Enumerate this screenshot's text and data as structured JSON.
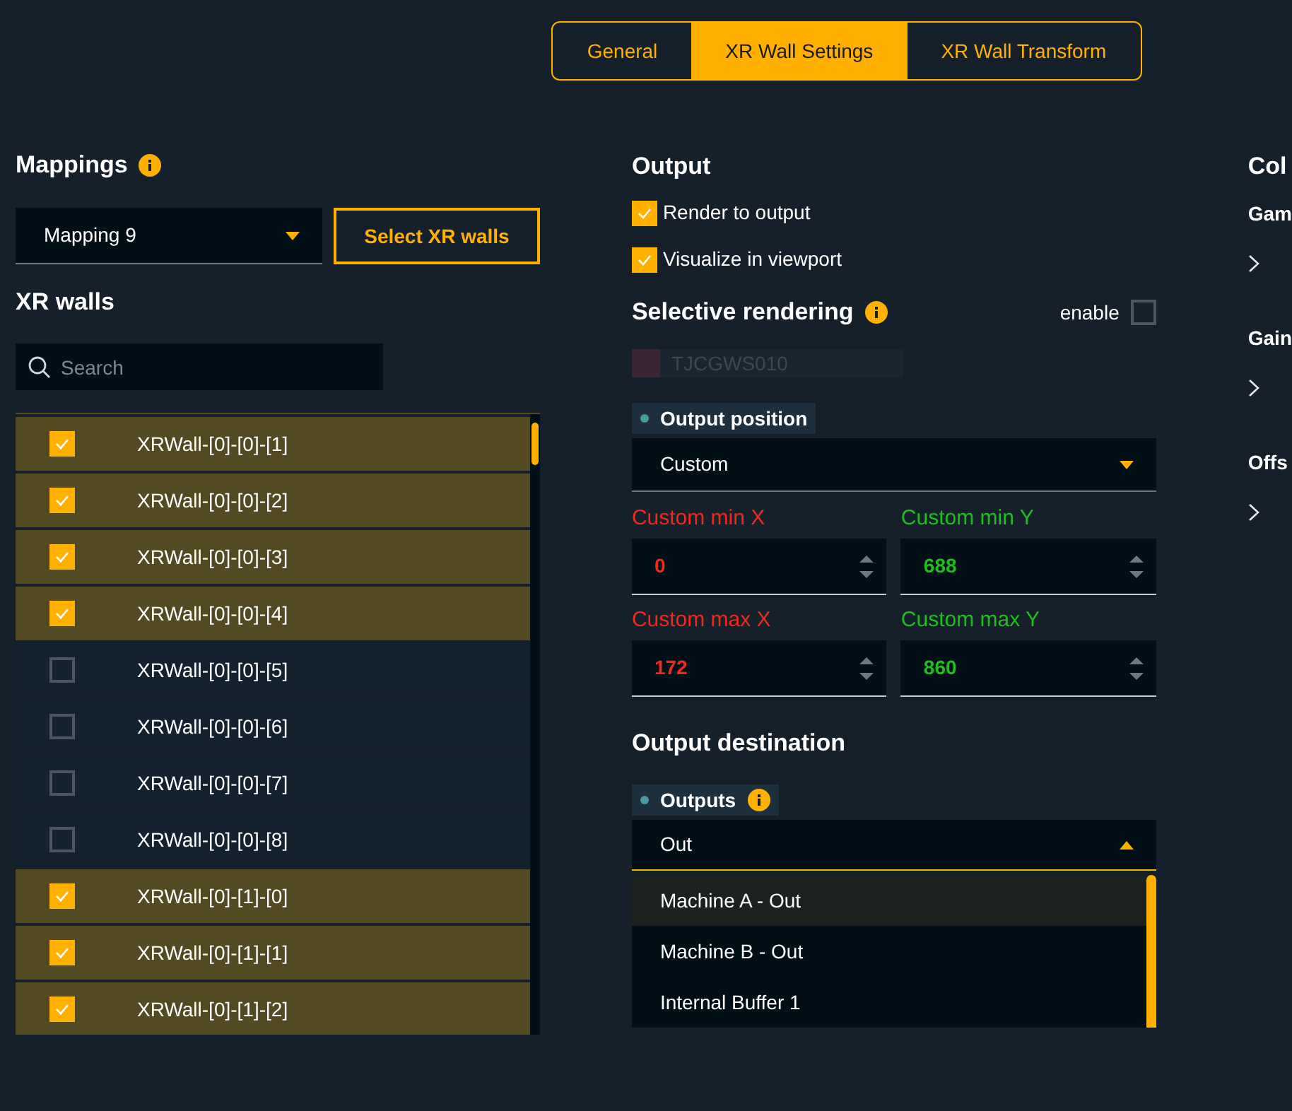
{
  "tabs": [
    {
      "label": "General",
      "selected": false
    },
    {
      "label": "XR Wall Settings",
      "selected": true
    },
    {
      "label": "XR Wall Transform",
      "selected": false
    }
  ],
  "mappings": {
    "title": "Mappings",
    "dropdown": {
      "value": "Mapping 9"
    },
    "button": "Select XR walls"
  },
  "xr_walls": {
    "title": "XR walls",
    "search": {
      "placeholder": "Search"
    },
    "items": [
      {
        "label": "XRWall-[0]-[0]-[1]",
        "checked": true
      },
      {
        "label": "XRWall-[0]-[0]-[2]",
        "checked": true
      },
      {
        "label": "XRWall-[0]-[0]-[3]",
        "checked": true
      },
      {
        "label": "XRWall-[0]-[0]-[4]",
        "checked": true
      },
      {
        "label": "XRWall-[0]-[0]-[5]",
        "checked": false
      },
      {
        "label": "XRWall-[0]-[0]-[6]",
        "checked": false
      },
      {
        "label": "XRWall-[0]-[0]-[7]",
        "checked": false
      },
      {
        "label": "XRWall-[0]-[0]-[8]",
        "checked": false
      },
      {
        "label": "XRWall-[0]-[1]-[0]",
        "checked": true
      },
      {
        "label": "XRWall-[0]-[1]-[1]",
        "checked": true
      },
      {
        "label": "XRWall-[0]-[1]-[2]",
        "checked": true
      }
    ]
  },
  "output": {
    "title": "Output",
    "checkboxes": [
      {
        "label": "Render to output",
        "checked": true
      },
      {
        "label": "Visualize in viewport",
        "checked": true
      }
    ],
    "selective_rendering": {
      "title": "Selective rendering",
      "enable_label": "enable",
      "enabled": false,
      "machine": {
        "name": "TJCGWS010",
        "disabled": true
      }
    },
    "output_position": {
      "label": "Output position",
      "dropdown": {
        "value": "Custom"
      },
      "fields": [
        {
          "label": "Custom min X",
          "value": "0",
          "color": "#ee2a1c"
        },
        {
          "label": "Custom min Y",
          "value": "688",
          "color": "#1dbf1d"
        },
        {
          "label": "Custom max X",
          "value": "172",
          "color": "#ee2a1c"
        },
        {
          "label": "Custom max Y",
          "value": "860",
          "color": "#1dbf1d"
        }
      ]
    },
    "output_destination": {
      "title": "Output destination",
      "outputs": {
        "label": "Outputs",
        "value": "Out",
        "expanded": true,
        "options": [
          {
            "label": "Machine A - Out",
            "selected": true
          },
          {
            "label": "Machine B - Out",
            "selected": false
          },
          {
            "label": "Internal Buffer 1",
            "selected": false
          }
        ]
      }
    }
  },
  "color_panel": {
    "title": "Col",
    "groups": [
      {
        "title": "Gam"
      },
      {
        "title": "Gain"
      },
      {
        "title": "Offs"
      }
    ]
  }
}
